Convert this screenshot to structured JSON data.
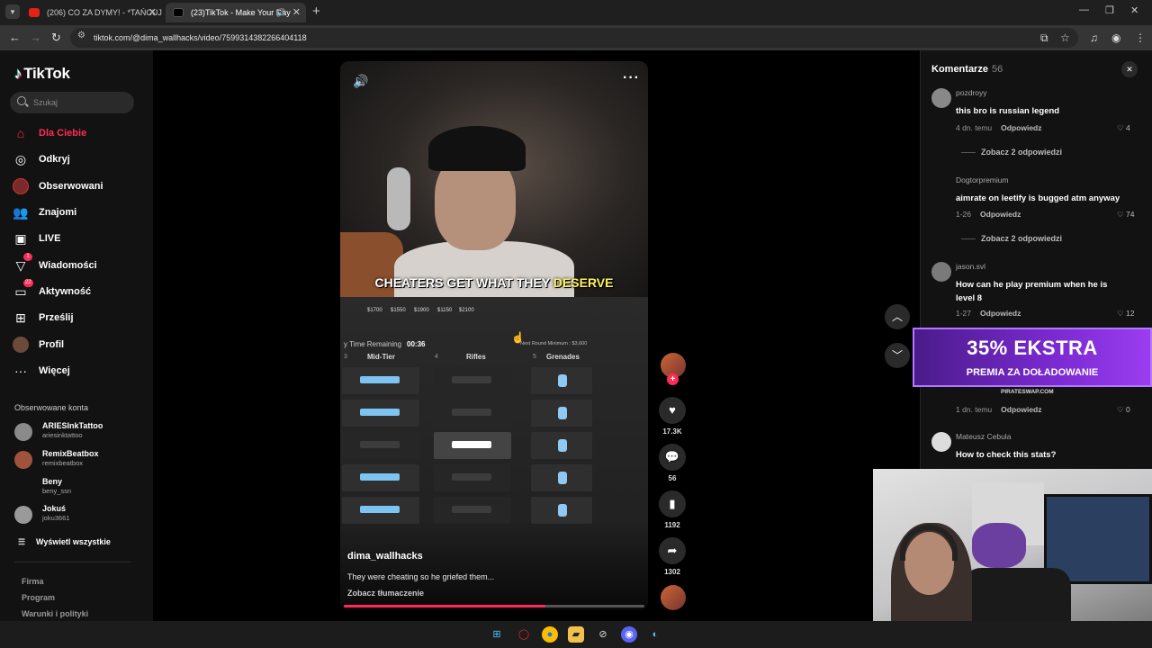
{
  "browser": {
    "tabs": [
      {
        "title": "(206) CO ZA DYMY! - *TAŃCUJ",
        "active": false
      },
      {
        "title": "(23)TikTok - Make Your Day",
        "active": true
      }
    ],
    "url": "tiktok.com/@dima_wallhacks/video/7599314382266404118"
  },
  "sidebar": {
    "logo": "TikTok",
    "search_placeholder": "Szukaj",
    "nav": [
      {
        "label": "Dla Ciebie",
        "icon": "home-icon"
      },
      {
        "label": "Odkryj",
        "icon": "compass-icon"
      },
      {
        "label": "Obserwowani",
        "icon": "avatar-icon"
      },
      {
        "label": "Znajomi",
        "icon": "people-icon"
      },
      {
        "label": "LIVE",
        "icon": "live-icon"
      },
      {
        "label": "Wiadomości",
        "icon": "send-icon",
        "badge": "1"
      },
      {
        "label": "Aktywność",
        "icon": "message-icon",
        "badge": "22"
      },
      {
        "label": "Prześlij",
        "icon": "upload-icon"
      },
      {
        "label": "Profil",
        "icon": "profile-icon"
      },
      {
        "label": "Więcej",
        "icon": "more-icon"
      }
    ],
    "followed_header": "Obserwowane konta",
    "accounts": [
      {
        "name": "ARIESInkTattoo",
        "handle": "ariesinktattoo"
      },
      {
        "name": "RemixBeatbox",
        "handle": "remixbeatbox"
      },
      {
        "name": "Beny",
        "handle": "beny_ssn"
      },
      {
        "name": "Jokuś",
        "handle": "joku3661"
      }
    ],
    "show_all": "Wyświetl wszystkie",
    "footer": [
      "Firma",
      "Program",
      "Warunki i polityki"
    ]
  },
  "video": {
    "caption_main": "CHEATERS GET WHAT THEY",
    "caption_highlight": "DESERVE",
    "prices": [
      "$1700",
      "$1550",
      "$1900",
      "$1150",
      "$2100"
    ],
    "buy_time_label": "y Time Remaining",
    "buy_time_value": "00:36",
    "next_round": "Next Round Minimum : $3,600",
    "columns": [
      {
        "num": "3",
        "label": "Mid-Tier"
      },
      {
        "num": "4",
        "label": "Rifles"
      },
      {
        "num": "5",
        "label": "Grenades"
      }
    ],
    "grenades": [
      "Flashbang",
      "Smoke Grenade",
      "High Explosive Grenade",
      "Incendiary Grenade",
      "Decoy Grenade"
    ],
    "username": "dima_wallhacks",
    "description": "They were cheating so he griefed them...",
    "translate": "Zobacz tłumaczenie",
    "progress": 0.67
  },
  "actions": {
    "likes": "17.3K",
    "comments": "56",
    "saves": "1192",
    "shares": "1302"
  },
  "comments": {
    "title": "Komentarze",
    "count": "56",
    "items": [
      {
        "user": "pozdroyy",
        "text": "this bro is russian legend",
        "date": "4 dn. temu",
        "reply": "Odpowiedz",
        "likes": "4",
        "more": "Zobacz 2 odpowiedzi"
      },
      {
        "user": "Dogtorpremium",
        "text": "aimrate on leetify is bugged atm anyway",
        "date": "1-26",
        "reply": "Odpowiedz",
        "likes": "74",
        "more": "Zobacz 2 odpowiedzi"
      },
      {
        "user": "jason.svl",
        "text": "How can he play premium when he is level 8",
        "date": "1-27",
        "reply": "Odpowiedz",
        "likes": "12"
      },
      {
        "user": "",
        "text": "",
        "date": "1 dn. temu",
        "reply": "Odpowiedz",
        "likes": "0"
      },
      {
        "user": "Mateusz Cebula",
        "text": "How to check this stats?",
        "date": "",
        "reply": "",
        "likes": ""
      }
    ]
  },
  "ad": {
    "headline": "35% EKSTRA",
    "sub": "PREMIA ZA DOŁADOWANIE",
    "domain": "PIRATESWAP.COM"
  }
}
